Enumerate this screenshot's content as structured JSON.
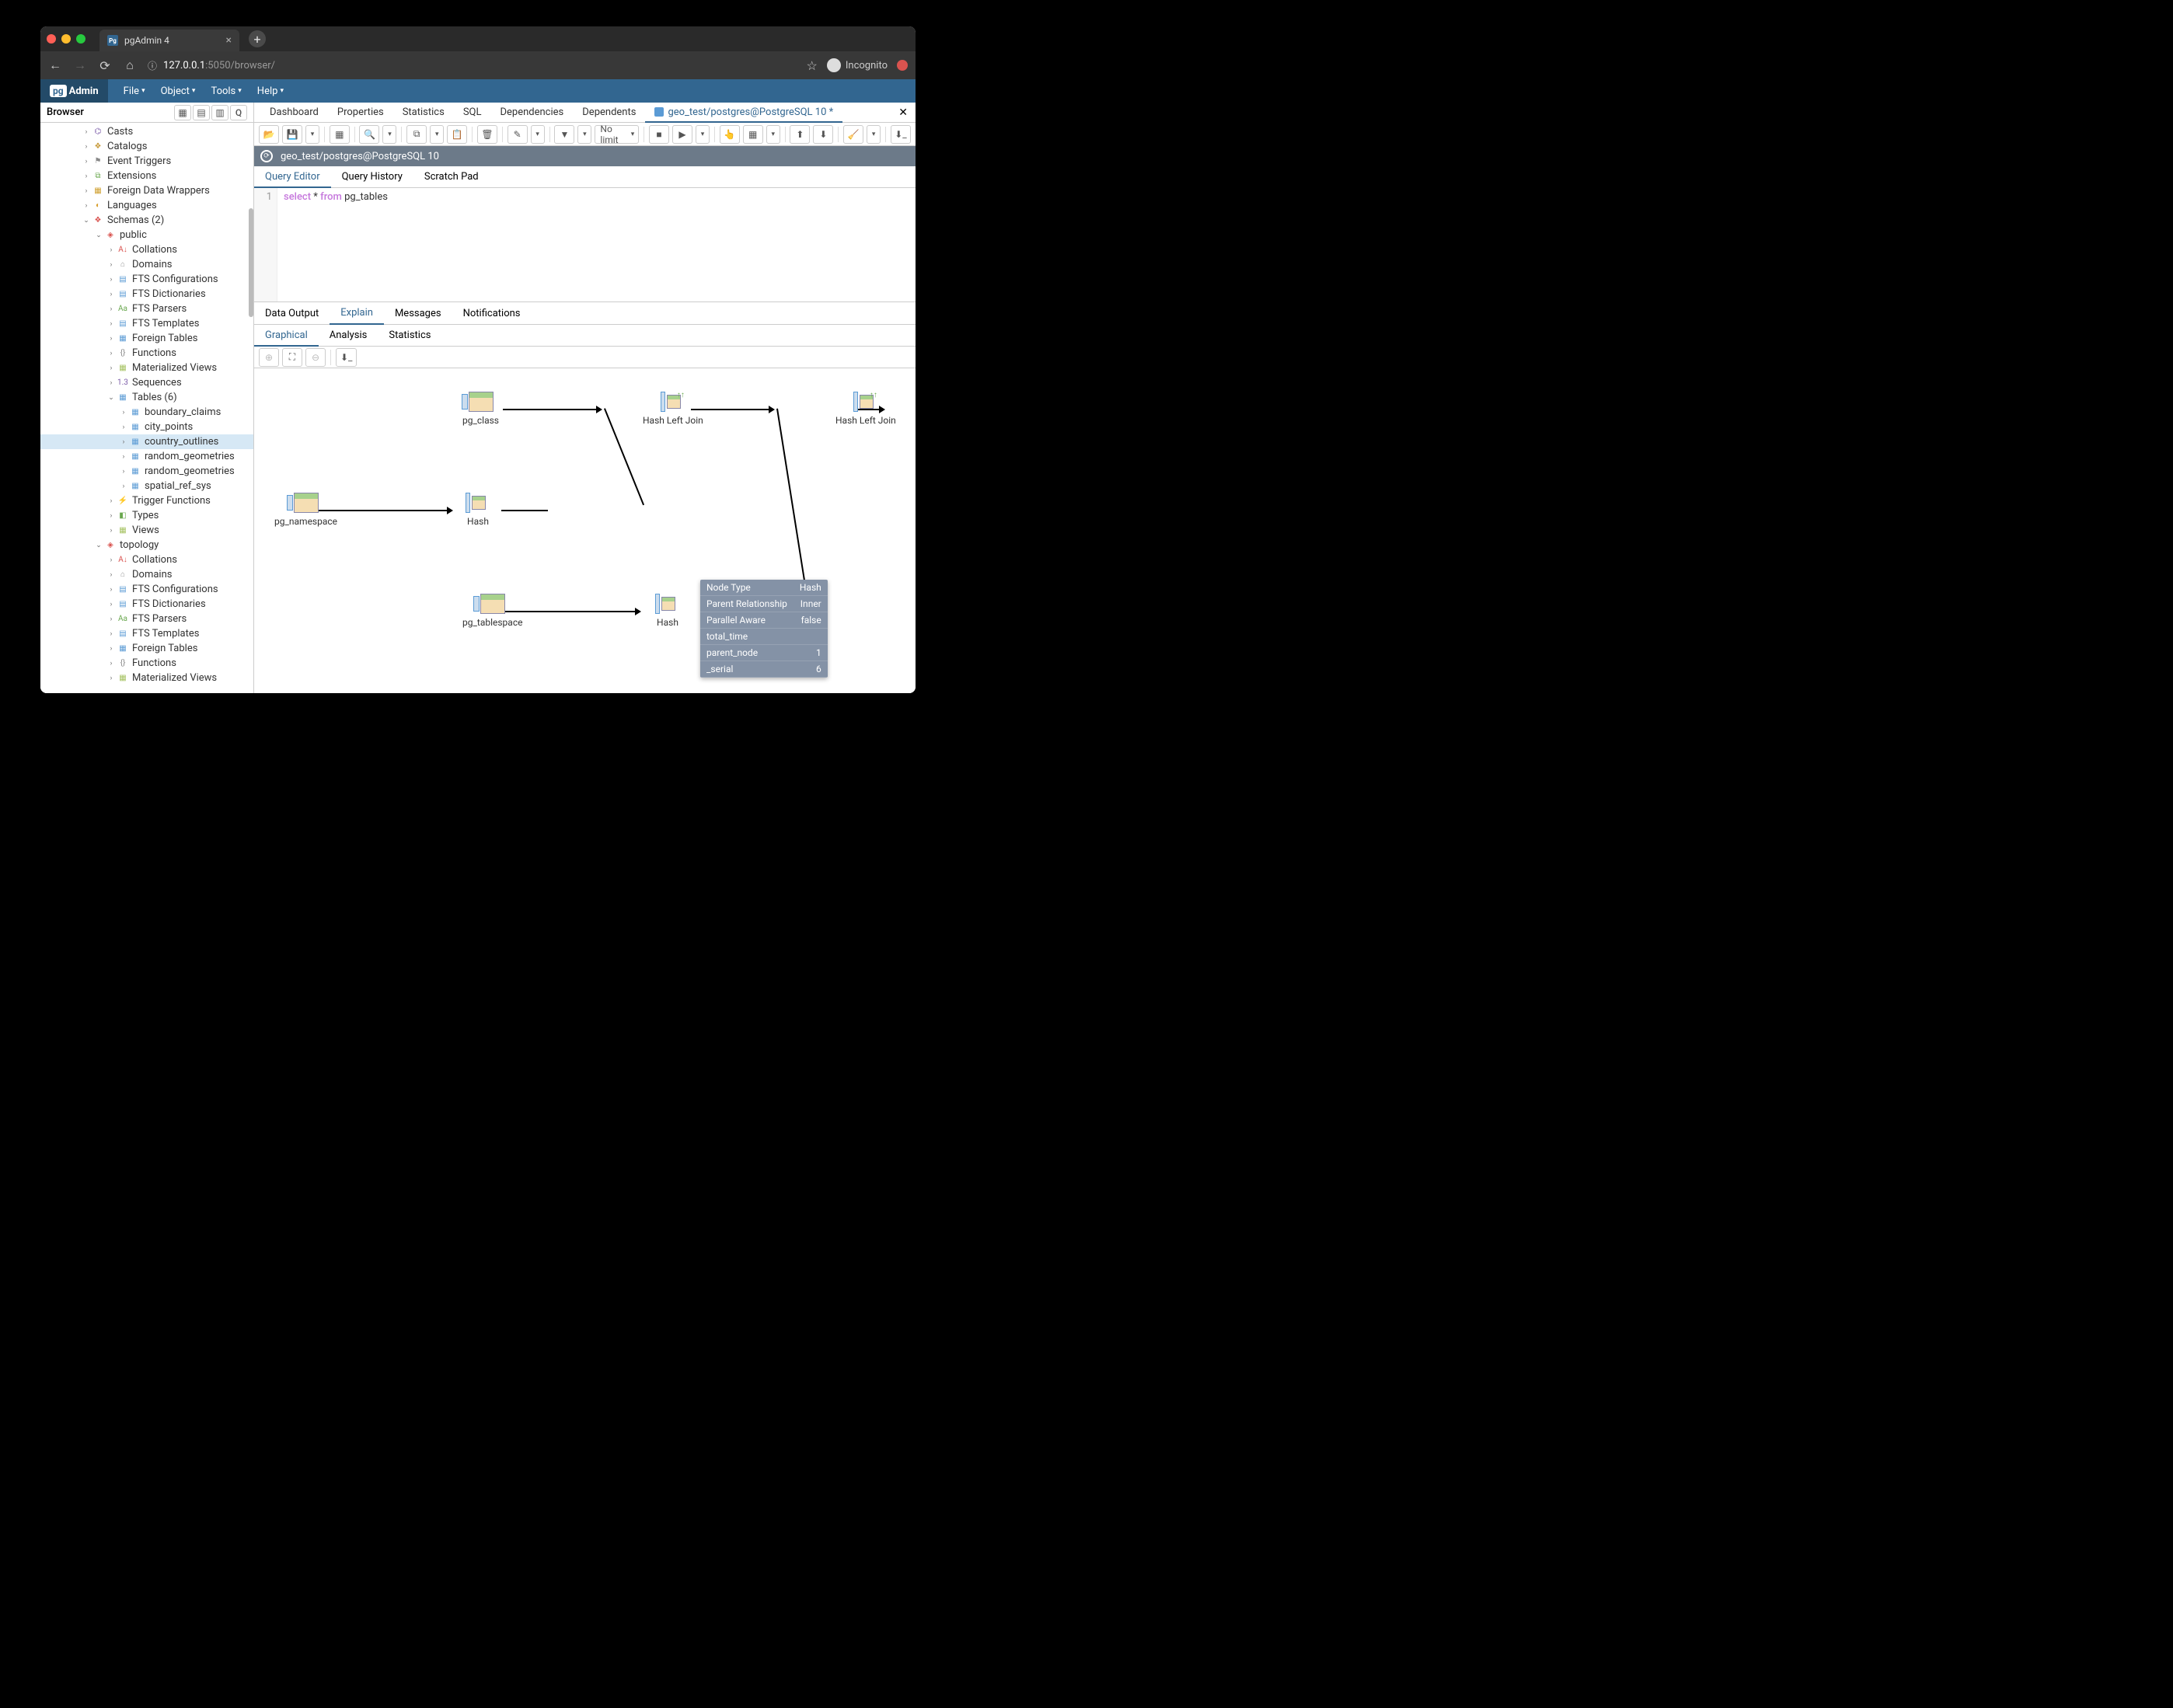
{
  "browser": {
    "tab_title": "pgAdmin 4",
    "url_host": "127.0.0.1",
    "url_port_path": ":5050/browser/",
    "incognito_label": "Incognito"
  },
  "menubar": {
    "brand": "Admin",
    "items": [
      "File",
      "Object",
      "Tools",
      "Help"
    ]
  },
  "browser_panel": {
    "title": "Browser",
    "tree": [
      {
        "depth": 3,
        "arrow": "›",
        "icon": "ic-casts",
        "glyph": "⌬",
        "label": "Casts"
      },
      {
        "depth": 3,
        "arrow": "›",
        "icon": "ic-catalog",
        "glyph": "❖",
        "label": "Catalogs"
      },
      {
        "depth": 3,
        "arrow": "›",
        "icon": "ic-event",
        "glyph": "⚑",
        "label": "Event Triggers"
      },
      {
        "depth": 3,
        "arrow": "›",
        "icon": "ic-ext",
        "glyph": "⧉",
        "label": "Extensions"
      },
      {
        "depth": 3,
        "arrow": "›",
        "icon": "ic-fdw",
        "glyph": "▦",
        "label": "Foreign Data Wrappers"
      },
      {
        "depth": 3,
        "arrow": "›",
        "icon": "ic-lang",
        "glyph": "◐",
        "label": "Languages"
      },
      {
        "depth": 3,
        "arrow": "⌄",
        "icon": "ic-schema",
        "glyph": "❖",
        "label": "Schemas (2)"
      },
      {
        "depth": 4,
        "arrow": "⌄",
        "icon": "ic-public",
        "glyph": "◈",
        "label": "public"
      },
      {
        "depth": 5,
        "arrow": "›",
        "icon": "ic-coll",
        "glyph": "A↓",
        "label": "Collations"
      },
      {
        "depth": 5,
        "arrow": "›",
        "icon": "ic-domain",
        "glyph": "⌂",
        "label": "Domains"
      },
      {
        "depth": 5,
        "arrow": "›",
        "icon": "ic-fts",
        "glyph": "▤",
        "label": "FTS Configurations"
      },
      {
        "depth": 5,
        "arrow": "›",
        "icon": "ic-fts",
        "glyph": "▤",
        "label": "FTS Dictionaries"
      },
      {
        "depth": 5,
        "arrow": "›",
        "icon": "ic-ftsp",
        "glyph": "Aa",
        "label": "FTS Parsers"
      },
      {
        "depth": 5,
        "arrow": "›",
        "icon": "ic-ftst",
        "glyph": "▤",
        "label": "FTS Templates"
      },
      {
        "depth": 5,
        "arrow": "›",
        "icon": "ic-ftable",
        "glyph": "▦",
        "label": "Foreign Tables"
      },
      {
        "depth": 5,
        "arrow": "›",
        "icon": "ic-func",
        "glyph": "{}",
        "label": "Functions"
      },
      {
        "depth": 5,
        "arrow": "›",
        "icon": "ic-mview",
        "glyph": "▦",
        "label": "Materialized Views"
      },
      {
        "depth": 5,
        "arrow": "›",
        "icon": "ic-seq",
        "glyph": "1.3",
        "label": "Sequences"
      },
      {
        "depth": 5,
        "arrow": "⌄",
        "icon": "ic-tables",
        "glyph": "▦",
        "label": "Tables (6)"
      },
      {
        "depth": 6,
        "arrow": "›",
        "icon": "ic-table",
        "glyph": "▦",
        "label": "boundary_claims"
      },
      {
        "depth": 6,
        "arrow": "›",
        "icon": "ic-table",
        "glyph": "▦",
        "label": "city_points"
      },
      {
        "depth": 6,
        "arrow": "›",
        "icon": "ic-table",
        "glyph": "▦",
        "label": "country_outlines",
        "selected": true
      },
      {
        "depth": 6,
        "arrow": "›",
        "icon": "ic-table",
        "glyph": "▦",
        "label": "random_geometries"
      },
      {
        "depth": 6,
        "arrow": "›",
        "icon": "ic-table",
        "glyph": "▦",
        "label": "random_geometries"
      },
      {
        "depth": 6,
        "arrow": "›",
        "icon": "ic-table",
        "glyph": "▦",
        "label": "spatial_ref_sys"
      },
      {
        "depth": 5,
        "arrow": "›",
        "icon": "ic-trigf",
        "glyph": "⚡",
        "label": "Trigger Functions"
      },
      {
        "depth": 5,
        "arrow": "›",
        "icon": "ic-types",
        "glyph": "◧",
        "label": "Types"
      },
      {
        "depth": 5,
        "arrow": "›",
        "icon": "ic-views",
        "glyph": "▦",
        "label": "Views"
      },
      {
        "depth": 4,
        "arrow": "⌄",
        "icon": "ic-public",
        "glyph": "◈",
        "label": "topology"
      },
      {
        "depth": 5,
        "arrow": "›",
        "icon": "ic-coll",
        "glyph": "A↓",
        "label": "Collations"
      },
      {
        "depth": 5,
        "arrow": "›",
        "icon": "ic-domain",
        "glyph": "⌂",
        "label": "Domains"
      },
      {
        "depth": 5,
        "arrow": "›",
        "icon": "ic-fts",
        "glyph": "▤",
        "label": "FTS Configurations"
      },
      {
        "depth": 5,
        "arrow": "›",
        "icon": "ic-fts",
        "glyph": "▤",
        "label": "FTS Dictionaries"
      },
      {
        "depth": 5,
        "arrow": "›",
        "icon": "ic-ftsp",
        "glyph": "Aa",
        "label": "FTS Parsers"
      },
      {
        "depth": 5,
        "arrow": "›",
        "icon": "ic-ftst",
        "glyph": "▤",
        "label": "FTS Templates"
      },
      {
        "depth": 5,
        "arrow": "›",
        "icon": "ic-ftable",
        "glyph": "▦",
        "label": "Foreign Tables"
      },
      {
        "depth": 5,
        "arrow": "›",
        "icon": "ic-func",
        "glyph": "{}",
        "label": "Functions"
      },
      {
        "depth": 5,
        "arrow": "›",
        "icon": "ic-mview",
        "glyph": "▦",
        "label": "Materialized Views"
      }
    ]
  },
  "main_tabs": [
    "Dashboard",
    "Properties",
    "Statistics",
    "SQL",
    "Dependencies",
    "Dependents"
  ],
  "query_tab": "geo_test/postgres@PostgreSQL 10 *",
  "toolbar": {
    "limit": "No limit"
  },
  "connection": "geo_test/postgres@PostgreSQL 10",
  "editor_tabs": [
    "Query Editor",
    "Query History",
    "Scratch Pad"
  ],
  "code": {
    "line_no": "1",
    "kw1": "select",
    "op": "*",
    "kw2": "from",
    "ident": "pg_tables"
  },
  "output_tabs": [
    "Data Output",
    "Explain",
    "Messages",
    "Notifications"
  ],
  "explain_subtabs": [
    "Graphical",
    "Analysis",
    "Statistics"
  ],
  "plan_nodes": {
    "pg_class": "pg_class",
    "pg_namespace": "pg_namespace",
    "pg_tablespace": "pg_tablespace",
    "hash1": "Hash",
    "hash2": "Hash",
    "hlj1": "Hash Left Join",
    "hlj2": "Hash Left Join"
  },
  "tooltip": [
    [
      "Node Type",
      "Hash"
    ],
    [
      "Parent Relationship",
      "Inner"
    ],
    [
      "Parallel Aware",
      "false"
    ],
    [
      "total_time",
      ""
    ],
    [
      "parent_node",
      "1"
    ],
    [
      "_serial",
      "6"
    ]
  ]
}
